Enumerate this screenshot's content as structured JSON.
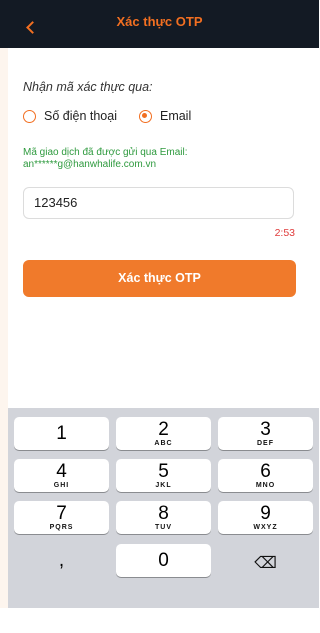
{
  "header": {
    "title": "Xác thực OTP",
    "back_icon": "chevron-left-icon",
    "accent": "#f26f21"
  },
  "verify": {
    "via_label": "Nhận mã xác thực qua:",
    "options": [
      {
        "label": "Số điện thoại",
        "selected": false
      },
      {
        "label": "Email",
        "selected": true
      }
    ],
    "sent_message_line1": "Mã giao dịch đã được gửi qua Email:",
    "sent_message_line2": "an******g@hanwhalife.com.vn",
    "otp_value": "123456",
    "timer": "2:53",
    "submit_label": "Xác thực OTP"
  },
  "keyboard": {
    "keys": [
      {
        "num": "1",
        "sub": ""
      },
      {
        "num": "2",
        "sub": "ABC"
      },
      {
        "num": "3",
        "sub": "DEF"
      },
      {
        "num": "4",
        "sub": "GHI"
      },
      {
        "num": "5",
        "sub": "JKL"
      },
      {
        "num": "6",
        "sub": "MNO"
      },
      {
        "num": "7",
        "sub": "PQRS"
      },
      {
        "num": "8",
        "sub": "TUV"
      },
      {
        "num": "9",
        "sub": "WXYZ"
      },
      {
        "num": ",",
        "sub": ""
      },
      {
        "num": "0",
        "sub": ""
      },
      {
        "num": "⌫",
        "sub": ""
      }
    ]
  }
}
